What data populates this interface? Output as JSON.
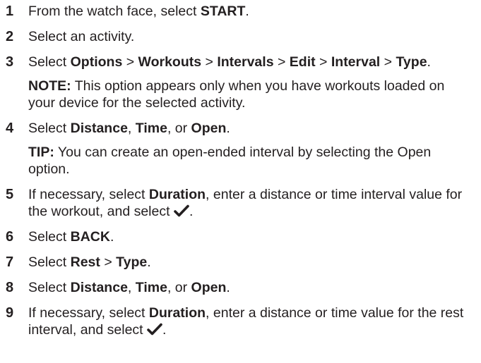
{
  "steps": [
    {
      "number": "1",
      "parts": [
        "From the watch face, select ",
        "START",
        "."
      ]
    },
    {
      "number": "2",
      "parts": [
        "Select an activity."
      ]
    },
    {
      "number": "3",
      "parts": [
        "Select ",
        "Options",
        " > ",
        "Workouts",
        " > ",
        "Intervals",
        " > ",
        "Edit",
        " > ",
        "Interval",
        " > ",
        "Type",
        "."
      ],
      "note": {
        "label": "NOTE:",
        "text": " This option appears only when you have workouts loaded on your device for the selected activity."
      }
    },
    {
      "number": "4",
      "parts": [
        "Select ",
        "Distance",
        ", ",
        "Time",
        ", or ",
        "Open",
        "."
      ],
      "note": {
        "label": "TIP:",
        "text": " You can create an open-ended interval by selecting the Open option."
      }
    },
    {
      "number": "5",
      "parts": [
        "If necessary, select ",
        "Duration",
        ", enter a distance or time interval value for the workout, and select ",
        "."
      ]
    },
    {
      "number": "6",
      "parts": [
        "Select ",
        "BACK",
        "."
      ]
    },
    {
      "number": "7",
      "parts": [
        "Select ",
        "Rest",
        " > ",
        "Type",
        "."
      ]
    },
    {
      "number": "8",
      "parts": [
        "Select ",
        "Distance",
        ", ",
        "Time",
        ", or ",
        "Open",
        "."
      ]
    },
    {
      "number": "9",
      "parts": [
        "If necessary, select ",
        "Duration",
        ", enter a distance or time value for the rest interval, and select ",
        "."
      ]
    }
  ],
  "icons": {
    "confirm": "check-icon"
  }
}
